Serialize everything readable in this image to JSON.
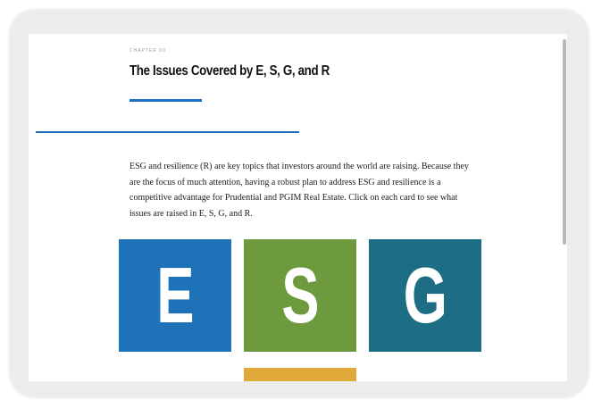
{
  "page": {
    "kicker": "CHAPTER 00",
    "title": "The Issues Covered by E, S, G, and R",
    "intro": "ESG and resilience (R) are key topics that investors around the world are raising. Because they are the focus of much attention, having a robust plan to address ESG and resilience is a competitive advantage for Prudential and PGIM Real Estate. Click on each card to see what issues are raised in E, S, G, and R."
  },
  "cards": [
    {
      "letter": "E",
      "color": "#1e72b8"
    },
    {
      "letter": "S",
      "color": "#6e9a3e"
    },
    {
      "letter": "G",
      "color": "#1d6d84"
    },
    {
      "letter": "",
      "color": "#e0a93a"
    }
  ],
  "colors": {
    "accent": "#1a6fc4",
    "frame": "#ececec"
  }
}
